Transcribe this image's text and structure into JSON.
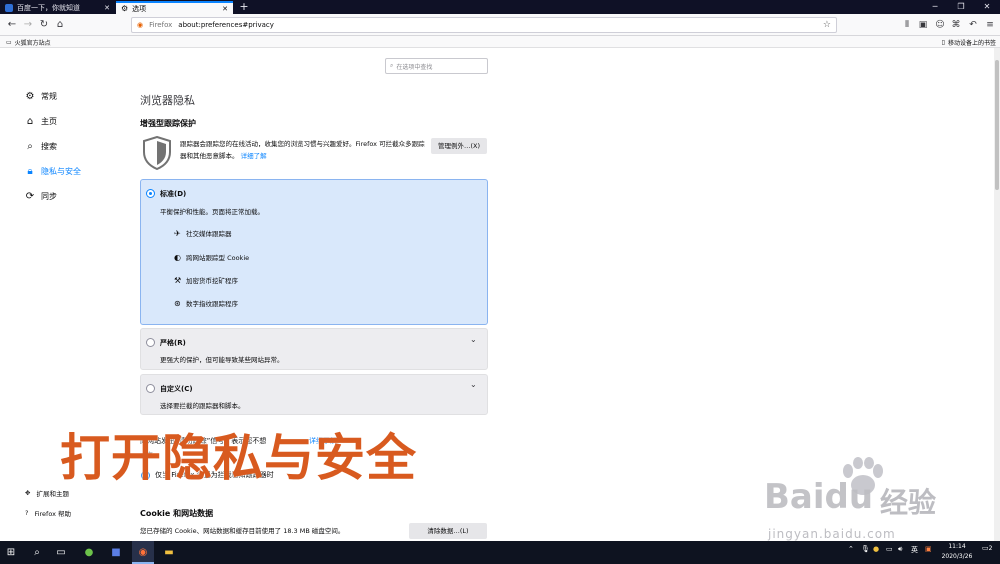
{
  "browser": {
    "tabs": [
      {
        "title": "百度一下，你就知道",
        "active": false
      },
      {
        "title": "选项",
        "active": true
      }
    ],
    "url_label": "Firefox",
    "url": "about:preferences#privacy",
    "bookmark_left": "火狐官方站点",
    "bookmark_right": "移动设备上的书签"
  },
  "search": {
    "placeholder": "在选项中查找"
  },
  "sidebar": {
    "items": [
      {
        "label": "常规",
        "icon": "gear-icon",
        "selected": false
      },
      {
        "label": "主页",
        "icon": "home-icon",
        "selected": false
      },
      {
        "label": "搜索",
        "icon": "search-icon",
        "selected": false
      },
      {
        "label": "隐私与安全",
        "icon": "lock-icon",
        "selected": true
      },
      {
        "label": "同步",
        "icon": "sync-icon",
        "selected": false
      }
    ],
    "footer": [
      {
        "label": "扩展和主题",
        "icon": "puzzle-icon"
      },
      {
        "label": "Firefox 帮助",
        "icon": "help-icon"
      }
    ]
  },
  "main": {
    "title": "浏览器隐私",
    "etp_heading": "增强型跟踪保护",
    "etp_desc": "跟踪器会跟踪您的在线活动，收集您的浏览习惯与兴趣爱好。Firefox 可拦截众多跟踪器和其他恶意脚本。",
    "learn_more": "详细了解",
    "manage_exceptions": "管理例外…(X)",
    "standard": {
      "title": "标准(D)",
      "desc": "平衡保护和性能。页面将正常加载。",
      "features": [
        "社交媒体跟踪器",
        "跨网站跟踪型 Cookie",
        "加密货币挖矿程序",
        "数字指纹跟踪程序"
      ]
    },
    "strict": {
      "title": "严格(R)",
      "desc": "更强大的保护，但可能导致某些网站异常。"
    },
    "custom": {
      "title": "自定义(C)",
      "desc": "选择要拦截的跟踪器和脚本。"
    },
    "dnt_partial_text": "向网站发出“请勿跟踪”信号，表示您不想",
    "dnt_partial_link": "详细了解",
    "dnt_partial_line": "一直",
    "dnt_option": "仅当 Firefox 设置为拦截已知跟踪器时",
    "cookie_heading": "Cookie 和网站数据",
    "cookie_desc": "您已存储的 Cookie、网站数据和缓存目前使用了 18.3 MB 磁盘空间。",
    "clear_data": "清除数据…(L)"
  },
  "overlay": {
    "caption": "打开隐私与安全"
  },
  "watermark": {
    "brand": "Bai",
    "brand2": "du",
    "cn": "经验",
    "url": "jingyan.baidu.com"
  },
  "taskbar": {
    "time": "11:14",
    "date": "2020/3/26",
    "ime": "英",
    "notify": "2"
  },
  "colors": {
    "accent": "#0a84ff",
    "overlay_text": "#d85a1f",
    "titlebar": "#0f1126"
  }
}
